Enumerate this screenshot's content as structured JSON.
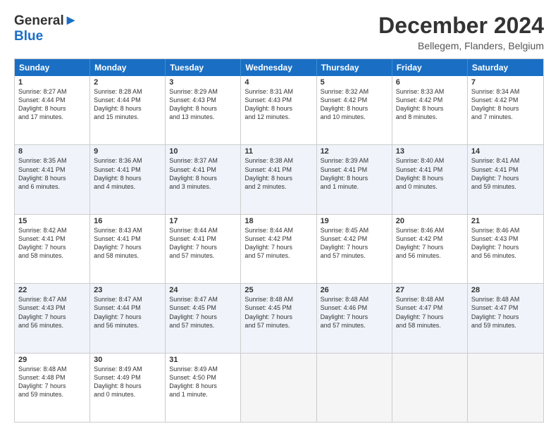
{
  "header": {
    "logo_line1_normal": "General",
    "logo_line1_blue": "",
    "logo_line2": "Blue",
    "month_title": "December 2024",
    "location": "Bellegem, Flanders, Belgium"
  },
  "days_of_week": [
    "Sunday",
    "Monday",
    "Tuesday",
    "Wednesday",
    "Thursday",
    "Friday",
    "Saturday"
  ],
  "weeks": [
    [
      {
        "day": 1,
        "info": "Sunrise: 8:27 AM\nSunset: 4:44 PM\nDaylight: 8 hours\nand 17 minutes."
      },
      {
        "day": 2,
        "info": "Sunrise: 8:28 AM\nSunset: 4:44 PM\nDaylight: 8 hours\nand 15 minutes."
      },
      {
        "day": 3,
        "info": "Sunrise: 8:29 AM\nSunset: 4:43 PM\nDaylight: 8 hours\nand 13 minutes."
      },
      {
        "day": 4,
        "info": "Sunrise: 8:31 AM\nSunset: 4:43 PM\nDaylight: 8 hours\nand 12 minutes."
      },
      {
        "day": 5,
        "info": "Sunrise: 8:32 AM\nSunset: 4:42 PM\nDaylight: 8 hours\nand 10 minutes."
      },
      {
        "day": 6,
        "info": "Sunrise: 8:33 AM\nSunset: 4:42 PM\nDaylight: 8 hours\nand 8 minutes."
      },
      {
        "day": 7,
        "info": "Sunrise: 8:34 AM\nSunset: 4:42 PM\nDaylight: 8 hours\nand 7 minutes."
      }
    ],
    [
      {
        "day": 8,
        "info": "Sunrise: 8:35 AM\nSunset: 4:41 PM\nDaylight: 8 hours\nand 6 minutes."
      },
      {
        "day": 9,
        "info": "Sunrise: 8:36 AM\nSunset: 4:41 PM\nDaylight: 8 hours\nand 4 minutes."
      },
      {
        "day": 10,
        "info": "Sunrise: 8:37 AM\nSunset: 4:41 PM\nDaylight: 8 hours\nand 3 minutes."
      },
      {
        "day": 11,
        "info": "Sunrise: 8:38 AM\nSunset: 4:41 PM\nDaylight: 8 hours\nand 2 minutes."
      },
      {
        "day": 12,
        "info": "Sunrise: 8:39 AM\nSunset: 4:41 PM\nDaylight: 8 hours\nand 1 minute."
      },
      {
        "day": 13,
        "info": "Sunrise: 8:40 AM\nSunset: 4:41 PM\nDaylight: 8 hours\nand 0 minutes."
      },
      {
        "day": 14,
        "info": "Sunrise: 8:41 AM\nSunset: 4:41 PM\nDaylight: 7 hours\nand 59 minutes."
      }
    ],
    [
      {
        "day": 15,
        "info": "Sunrise: 8:42 AM\nSunset: 4:41 PM\nDaylight: 7 hours\nand 58 minutes."
      },
      {
        "day": 16,
        "info": "Sunrise: 8:43 AM\nSunset: 4:41 PM\nDaylight: 7 hours\nand 58 minutes."
      },
      {
        "day": 17,
        "info": "Sunrise: 8:44 AM\nSunset: 4:41 PM\nDaylight: 7 hours\nand 57 minutes."
      },
      {
        "day": 18,
        "info": "Sunrise: 8:44 AM\nSunset: 4:42 PM\nDaylight: 7 hours\nand 57 minutes."
      },
      {
        "day": 19,
        "info": "Sunrise: 8:45 AM\nSunset: 4:42 PM\nDaylight: 7 hours\nand 57 minutes."
      },
      {
        "day": 20,
        "info": "Sunrise: 8:46 AM\nSunset: 4:42 PM\nDaylight: 7 hours\nand 56 minutes."
      },
      {
        "day": 21,
        "info": "Sunrise: 8:46 AM\nSunset: 4:43 PM\nDaylight: 7 hours\nand 56 minutes."
      }
    ],
    [
      {
        "day": 22,
        "info": "Sunrise: 8:47 AM\nSunset: 4:43 PM\nDaylight: 7 hours\nand 56 minutes."
      },
      {
        "day": 23,
        "info": "Sunrise: 8:47 AM\nSunset: 4:44 PM\nDaylight: 7 hours\nand 56 minutes."
      },
      {
        "day": 24,
        "info": "Sunrise: 8:47 AM\nSunset: 4:45 PM\nDaylight: 7 hours\nand 57 minutes."
      },
      {
        "day": 25,
        "info": "Sunrise: 8:48 AM\nSunset: 4:45 PM\nDaylight: 7 hours\nand 57 minutes."
      },
      {
        "day": 26,
        "info": "Sunrise: 8:48 AM\nSunset: 4:46 PM\nDaylight: 7 hours\nand 57 minutes."
      },
      {
        "day": 27,
        "info": "Sunrise: 8:48 AM\nSunset: 4:47 PM\nDaylight: 7 hours\nand 58 minutes."
      },
      {
        "day": 28,
        "info": "Sunrise: 8:48 AM\nSunset: 4:47 PM\nDaylight: 7 hours\nand 59 minutes."
      }
    ],
    [
      {
        "day": 29,
        "info": "Sunrise: 8:48 AM\nSunset: 4:48 PM\nDaylight: 7 hours\nand 59 minutes."
      },
      {
        "day": 30,
        "info": "Sunrise: 8:49 AM\nSunset: 4:49 PM\nDaylight: 8 hours\nand 0 minutes."
      },
      {
        "day": 31,
        "info": "Sunrise: 8:49 AM\nSunset: 4:50 PM\nDaylight: 8 hours\nand 1 minute."
      },
      null,
      null,
      null,
      null
    ]
  ]
}
